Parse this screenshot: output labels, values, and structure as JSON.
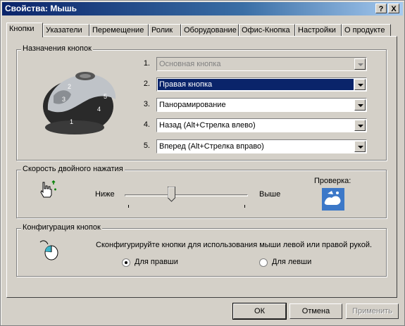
{
  "window": {
    "title": "Свойства: Мышь",
    "help_btn": "?",
    "close_btn": "X"
  },
  "tabs": [
    "Кнопки",
    "Указатели",
    "Перемещение",
    "Ролик",
    "Оборудование",
    "Офис-Кнопка",
    "Настройки",
    "О продукте"
  ],
  "button_assignments": {
    "group_label": "Назначения кнопок",
    "mouse_button_numbers": [
      "1",
      "2",
      "3",
      "4",
      "5"
    ],
    "rows": [
      {
        "number": "1.",
        "value": "Основная кнопка",
        "state": "disabled"
      },
      {
        "number": "2.",
        "value": "Правая кнопка",
        "state": "selected"
      },
      {
        "number": "3.",
        "value": "Панорамирование",
        "state": "normal"
      },
      {
        "number": "4.",
        "value": "Назад (Alt+Стрелка влево)",
        "state": "normal"
      },
      {
        "number": "5.",
        "value": "Вперед (Alt+Стрелка вправо)",
        "state": "normal"
      }
    ]
  },
  "double_click": {
    "group_label": "Скорость двойного нажатия",
    "slower": "Ниже",
    "faster": "Выше",
    "test_label": "Проверка:",
    "slider_level": 0.37
  },
  "config": {
    "group_label": "Конфигурация кнопок",
    "description": "Сконфигурируйте кнопки для использования мыши левой или правой рукой.",
    "right_handed": "Для правши",
    "left_handed": "Для левши",
    "selected": "right"
  },
  "footer": {
    "ok": "ОК",
    "cancel": "Отмена",
    "apply": "Применить"
  }
}
